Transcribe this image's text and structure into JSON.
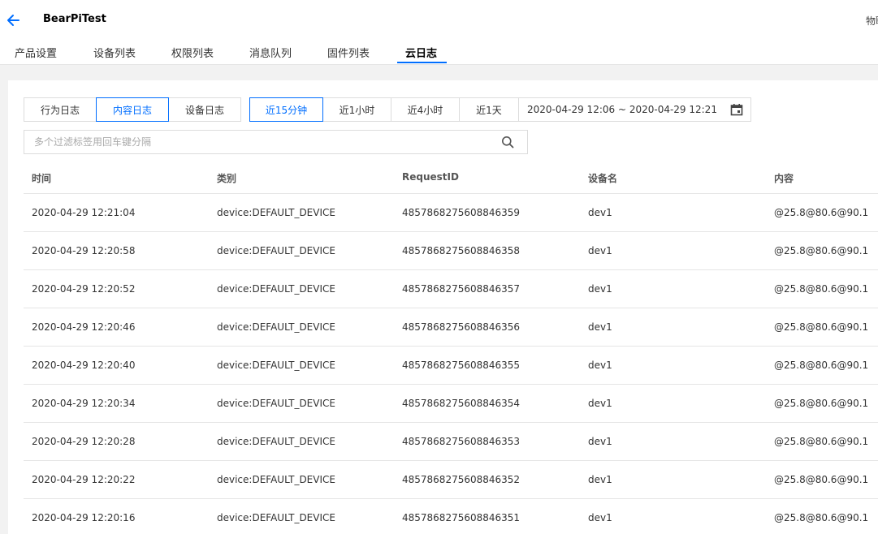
{
  "header": {
    "title": "BearPiTest",
    "corner_text": "物联"
  },
  "tabs": [
    {
      "label": "产品设置"
    },
    {
      "label": "设备列表"
    },
    {
      "label": "权限列表"
    },
    {
      "label": "消息队列"
    },
    {
      "label": "固件列表"
    },
    {
      "label": "云日志"
    }
  ],
  "active_tab": "云日志",
  "log_types": [
    {
      "label": "行为日志"
    },
    {
      "label": "内容日志"
    },
    {
      "label": "设备日志"
    }
  ],
  "selected_log_type": "内容日志",
  "time_ranges": [
    {
      "label": "近15分钟"
    },
    {
      "label": "近1小时"
    },
    {
      "label": "近4小时"
    },
    {
      "label": "近1天"
    }
  ],
  "selected_time_range": "近15分钟",
  "date_range": "2020-04-29 12:06 ~ 2020-04-29 12:21",
  "search": {
    "placeholder": "多个过滤标签用回车键分隔",
    "value": ""
  },
  "table": {
    "columns": [
      "时间",
      "类别",
      "RequestID",
      "设备名",
      "内容"
    ],
    "rows": [
      {
        "time": "2020-04-29 12:21:04",
        "category": "device:DEFAULT_DEVICE",
        "request_id": "4857868275608846359",
        "device": "dev1",
        "content": "@25.8@80.6@90.1"
      },
      {
        "time": "2020-04-29 12:20:58",
        "category": "device:DEFAULT_DEVICE",
        "request_id": "4857868275608846358",
        "device": "dev1",
        "content": "@25.8@80.6@90.1"
      },
      {
        "time": "2020-04-29 12:20:52",
        "category": "device:DEFAULT_DEVICE",
        "request_id": "4857868275608846357",
        "device": "dev1",
        "content": "@25.8@80.6@90.1"
      },
      {
        "time": "2020-04-29 12:20:46",
        "category": "device:DEFAULT_DEVICE",
        "request_id": "4857868275608846356",
        "device": "dev1",
        "content": "@25.8@80.6@90.1"
      },
      {
        "time": "2020-04-29 12:20:40",
        "category": "device:DEFAULT_DEVICE",
        "request_id": "4857868275608846355",
        "device": "dev1",
        "content": "@25.8@80.6@90.1"
      },
      {
        "time": "2020-04-29 12:20:34",
        "category": "device:DEFAULT_DEVICE",
        "request_id": "4857868275608846354",
        "device": "dev1",
        "content": "@25.8@80.6@90.1"
      },
      {
        "time": "2020-04-29 12:20:28",
        "category": "device:DEFAULT_DEVICE",
        "request_id": "4857868275608846353",
        "device": "dev1",
        "content": "@25.8@80.6@90.1"
      },
      {
        "time": "2020-04-29 12:20:22",
        "category": "device:DEFAULT_DEVICE",
        "request_id": "4857868275608846352",
        "device": "dev1",
        "content": "@25.8@80.6@90.1"
      },
      {
        "time": "2020-04-29 12:20:16",
        "category": "device:DEFAULT_DEVICE",
        "request_id": "4857868275608846351",
        "device": "dev1",
        "content": "@25.8@80.6@90.1"
      }
    ]
  },
  "icons": {
    "back": "arrow-left-icon",
    "calendar": "calendar-icon",
    "search": "search-icon"
  },
  "colors": {
    "accent": "#006eff",
    "border": "#dcdcdc",
    "background": "#f2f2f2"
  }
}
